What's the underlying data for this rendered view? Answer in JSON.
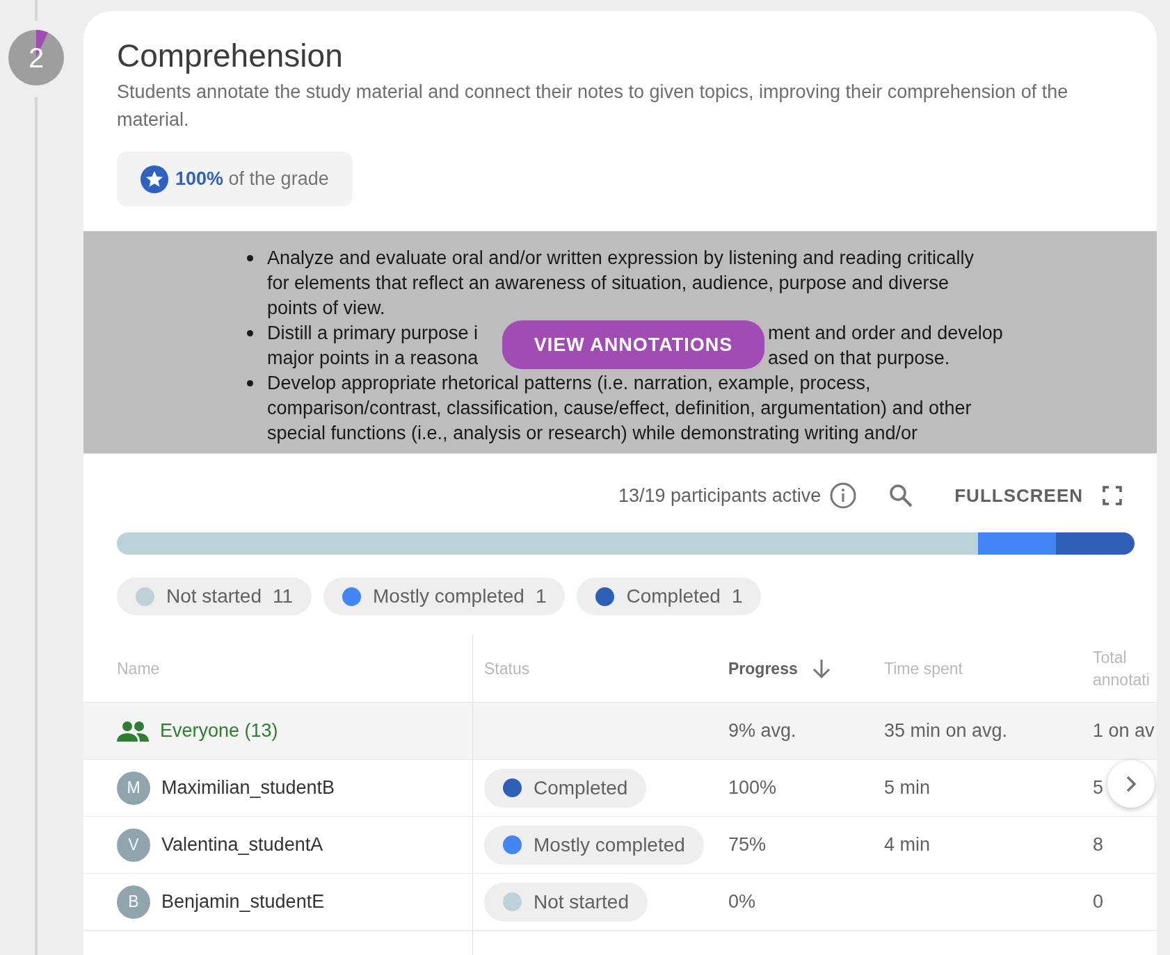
{
  "step": {
    "number": "2",
    "level": 0.07
  },
  "activity": {
    "title": "Comprehension",
    "description": "Students annotate the study material and connect their notes to given topics, improving their comprehension of the material.",
    "grade": "**100%** of the grade"
  },
  "document": {
    "bullets": [
      {
        "lines": [
          [
            "Analyze and evaluate oral and/or written expression by listening and reading critically"
          ],
          [
            "for elements that reflect an awareness of situation, audience, purpose and diverse"
          ],
          [
            "points of view."
          ]
        ]
      },
      {
        "lines": [
          [
            "Distill a primary purpose i",
            "ment and order and develop"
          ],
          [
            "major points in a reasona",
            "ased on that purpose."
          ]
        ]
      },
      {
        "lines": [
          [
            "Develop appropriate rhetorical patterns (i.e. narration, example, process,"
          ],
          [
            "comparison/contrast, classification, cause/effect, definition, argumentation) and other"
          ],
          [
            "special functions (i.e., analysis or research) while demonstrating writing and/or"
          ]
        ]
      }
    ],
    "button": "VIEW ANNOTATIONS"
  },
  "toolbar": {
    "participants": "13/19 participants active",
    "fullscreen": "FULLSCREEN"
  },
  "statuses": [
    {
      "label": "Not started",
      "count": "11",
      "color": "#bcd2d9"
    },
    {
      "label": "Mostly completed",
      "count": "1",
      "color": "#4285f4"
    },
    {
      "label": "Completed",
      "count": "1",
      "color": "#2f5fb5"
    }
  ],
  "table": {
    "columns": [
      {
        "label": "Name",
        "sorted": false
      },
      {
        "label": "Status",
        "sorted": false
      },
      {
        "label": "Progress",
        "sorted": true
      },
      {
        "label": "Time spent",
        "sorted": false
      },
      {
        "label": "Total annotati",
        "sorted": false
      }
    ],
    "summary": {
      "name": "Everyone (13)",
      "progress": "9% avg.",
      "time": "35 min on avg.",
      "total": "1 on av"
    },
    "rows": [
      {
        "initial": "M",
        "name": "Maximilian_studentB",
        "status": "Completed",
        "color": "#2f5fb5",
        "progress": "100%",
        "time": "5 min",
        "total": "5"
      },
      {
        "initial": "V",
        "name": "Valentina_studentA",
        "status": "Mostly completed",
        "color": "#4285f4",
        "progress": "75%",
        "time": "4 min",
        "total": "8"
      },
      {
        "initial": "B",
        "name": "Benjamin_studentE",
        "status": "Not started",
        "color": "#bcd2d9",
        "progress": "0%",
        "total": "0"
      }
    ]
  }
}
